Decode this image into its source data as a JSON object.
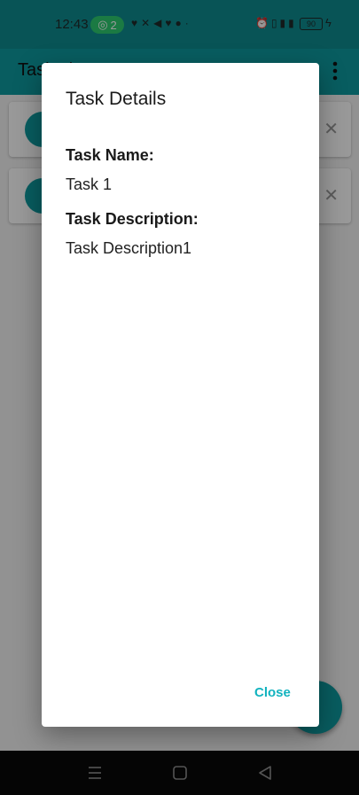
{
  "status_bar": {
    "time": "12:43",
    "hotspot_count": "2",
    "battery": "90"
  },
  "app_bar": {
    "title": "Task List"
  },
  "dialog": {
    "title": "Task Details",
    "name_label": "Task Name:",
    "name_value": "Task 1",
    "description_label": "Task Description:",
    "description_value": "Task Description1",
    "close_label": "Close"
  },
  "colors": {
    "primary": "#0e9ca0",
    "accent": "#12b3bf",
    "scrim": "rgba(0,0,0,0.40)"
  }
}
